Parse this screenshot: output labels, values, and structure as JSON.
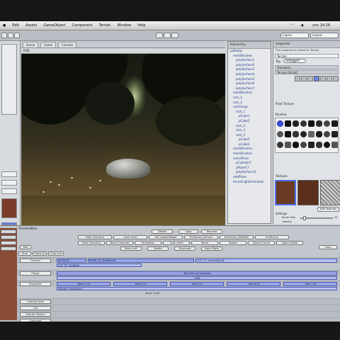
{
  "menubar": {
    "items": [
      "Edit",
      "Assets",
      "GameObject",
      "Component",
      "Terrain",
      "Window",
      "Help"
    ],
    "clock": "ons 14:26"
  },
  "toolbar": {
    "layers_label": "Layers",
    "layout_label": "Layout"
  },
  "scene": {
    "tabs": [
      "Scene",
      "Game",
      "Console"
    ],
    "render_mode": "RGB"
  },
  "hierarchy": {
    "title": "Hierarchy",
    "items": [
      "pathway",
      "meshBrushes",
      "polySurface1",
      "polySurface2",
      "polySurface3",
      "polySurface4",
      "polySurface5",
      "polySurface6",
      "polySurface7",
      "meshBrushes",
      "rock_1",
      "rock_2",
      "rockGroup",
      "rock_1",
      "pCube1",
      "pCube2",
      "rock_3",
      "rock_4",
      "rock_5",
      "pCube1",
      "pCube2",
      "meshBrushes",
      "meshBrushes",
      "rocksPlains",
      "pCylinder1",
      "pPlane17",
      "polySurface11",
      "rootPlane",
      "terrainLightAnimation"
    ]
  },
  "inspector": {
    "title": "Inspector",
    "notice": "This inspector is locked for Terrain",
    "object_name": "Terrain",
    "tag_label": "Tag",
    "tag_value": "Untagged",
    "components": [
      "Transform",
      "Terrain (Script)"
    ],
    "paint_label": "Paint Texture",
    "brushes_label": "Brushes",
    "textures_label": "Textures",
    "edit_textures_button": "Edit Textures",
    "settings_label": "Settings",
    "brush_size_label": "Brush Size",
    "brush_size_value": "25",
    "opacity_label": "Opacity",
    "opacity_value": "0.3",
    "target_strength_label": "Target Strength",
    "target_strength_value": "1"
  },
  "timeline": {
    "title": "TimelineMain",
    "top_buttons": [
      "Delete",
      "Copy",
      "Rename"
    ],
    "row2": [
      "Fade (Camera)",
      "Look Level",
      "Set LookAtTarget",
      "EndScene_BiOverl",
      "EndScene_BiSideFil",
      "EndScene"
    ],
    "row3": [
      "Fade (Camera)",
      "Move (Camera)",
      "Animation",
      "Look Level",
      "Move",
      "Rotate",
      "Signal (Send)",
      "Signal (Wait)"
    ],
    "row4": [
      "Move Left",
      "Delete",
      "Duplicate",
      "Move Right"
    ],
    "toolbar_left": [
      "Stop",
      "Show all",
      "Crop end"
    ],
    "add_button": "Add",
    "copy_button": "Copy",
    "tracks": [
      "Camera",
      "Player",
      "Puppeteer",
      "Camera Fade",
      "Cat",
      "Charlie Ottenm",
      "Computer",
      "Trees/Fence"
    ],
    "camera_clips": [
      "00:00.00",
      "BOMN_TO_TreeBirth01",
      "CUT_TO_TreeLongEnd1"
    ],
    "camera_subclip": "CUT_TO_TreeBirth",
    "player_clip": "Skip Pick-up Computer",
    "player_subclip": "HIDE",
    "puppeteer_clips": [
      "Wait 11.0s",
      "Wait 9.0s",
      "Wait 5.0s",
      "Wait 6.0s",
      "Wait 7.0s"
    ],
    "puppeteer_sub": "[Middle] TreesFader1",
    "cut_label": "Send \"Cut1\""
  }
}
